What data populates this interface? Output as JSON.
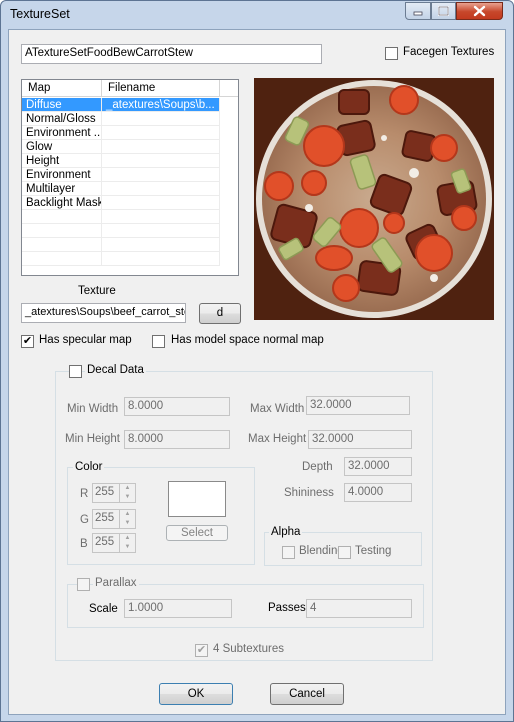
{
  "window": {
    "title": "TextureSet"
  },
  "editor_id": "ATextureSetFoodBewCarrotStew",
  "facegen": {
    "label": "Facegen Textures",
    "checked": false
  },
  "map_list": {
    "headers": [
      "Map",
      "Filename"
    ],
    "rows": [
      {
        "map": "Diffuse",
        "file": "_atextures\\Soups\\b...",
        "selected": true
      },
      {
        "map": "Normal/Gloss",
        "file": ""
      },
      {
        "map": "Environment ...",
        "file": ""
      },
      {
        "map": "Glow",
        "file": ""
      },
      {
        "map": "Height",
        "file": ""
      },
      {
        "map": "Environment",
        "file": ""
      },
      {
        "map": "Multilayer",
        "file": ""
      },
      {
        "map": "Backlight Mask",
        "file": ""
      }
    ]
  },
  "texture": {
    "label": "Texture",
    "path": "_atextures\\Soups\\beef_carrot_ste",
    "button_label": "d Image"
  },
  "preview": {
    "alt": "beef carrot stew texture"
  },
  "has_specular": {
    "label": "Has specular map",
    "checked": true
  },
  "has_model_space": {
    "label": "Has model space normal map",
    "checked": false
  },
  "decal": {
    "label": "Decal Data",
    "checked": false,
    "min_width_label": "Min Width",
    "min_width": "8.0000",
    "max_width_label": "Max Width",
    "max_width": "32.0000",
    "min_height_label": "Min Height",
    "min_height": "8.0000",
    "max_height_label": "Max Height",
    "max_height": "32.0000",
    "depth_label": "Depth",
    "depth": "32.0000",
    "shininess_label": "Shininess",
    "shininess": "4.0000",
    "color": {
      "label": "Color",
      "r_label": "R",
      "r": "255",
      "g_label": "G",
      "g": "255",
      "b_label": "B",
      "b": "255",
      "swatch": "#ffffff",
      "select_label": "Select"
    },
    "alpha": {
      "label": "Alpha",
      "blending_label": "Blending",
      "testing_label": "Testing"
    },
    "parallax": {
      "label": "Parallax",
      "scale_label": "Scale",
      "scale": "1.0000",
      "passes_label": "Passes",
      "passes": "4"
    },
    "subtextures": {
      "label": "4 Subtextures",
      "checked": true
    }
  },
  "buttons": {
    "ok": "OK",
    "cancel": "Cancel"
  }
}
